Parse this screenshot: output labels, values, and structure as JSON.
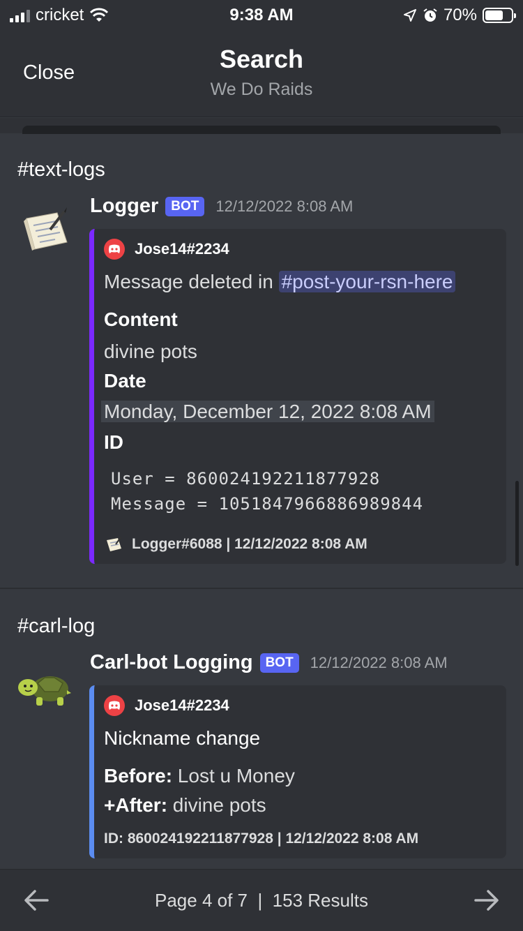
{
  "status_bar": {
    "carrier": "cricket",
    "time": "9:38 AM",
    "battery": "70%",
    "battery_level": 0.7
  },
  "header": {
    "close_label": "Close",
    "title": "Search",
    "subtitle": "We Do Raids"
  },
  "results": [
    {
      "channel": "#text-logs",
      "author": "Logger",
      "bot_tag": "BOT",
      "timestamp": "12/12/2022 8:08 AM",
      "avatar_icon": "notepad-icon",
      "embed": {
        "accent": "#7b29ff",
        "author": "Jose14#2234",
        "description_prefix": "Message deleted in",
        "mention": "#post-your-rsn-here",
        "fields": [
          {
            "name": "Content",
            "value": "divine pots"
          },
          {
            "name": "Date",
            "value": "Monday, December 12, 2022 8:08 AM"
          },
          {
            "name": "ID",
            "value": ""
          }
        ],
        "code_lines": [
          "User = 860024192211877928",
          "Message = 1051847966886989844"
        ],
        "footer": "Logger#6088 | 12/12/2022 8:08 AM"
      }
    },
    {
      "channel": "#carl-log",
      "author": "Carl-bot Logging",
      "bot_tag": "BOT",
      "timestamp": "12/12/2022 8:08 AM",
      "avatar_icon": "turtle-icon",
      "embed": {
        "accent": "#5b8cf0",
        "author": "Jose14#2234",
        "title": "Nickname change",
        "before_label": "Before:",
        "before_value": "Lost u Money",
        "after_label": "+After:",
        "after_value": "divine pots",
        "footer": "ID: 860024192211877928 | 12/12/2022 8:08 AM"
      }
    }
  ],
  "pager": {
    "page_text": "Page 4 of 7",
    "separator": "|",
    "results_text": "153 Results"
  }
}
